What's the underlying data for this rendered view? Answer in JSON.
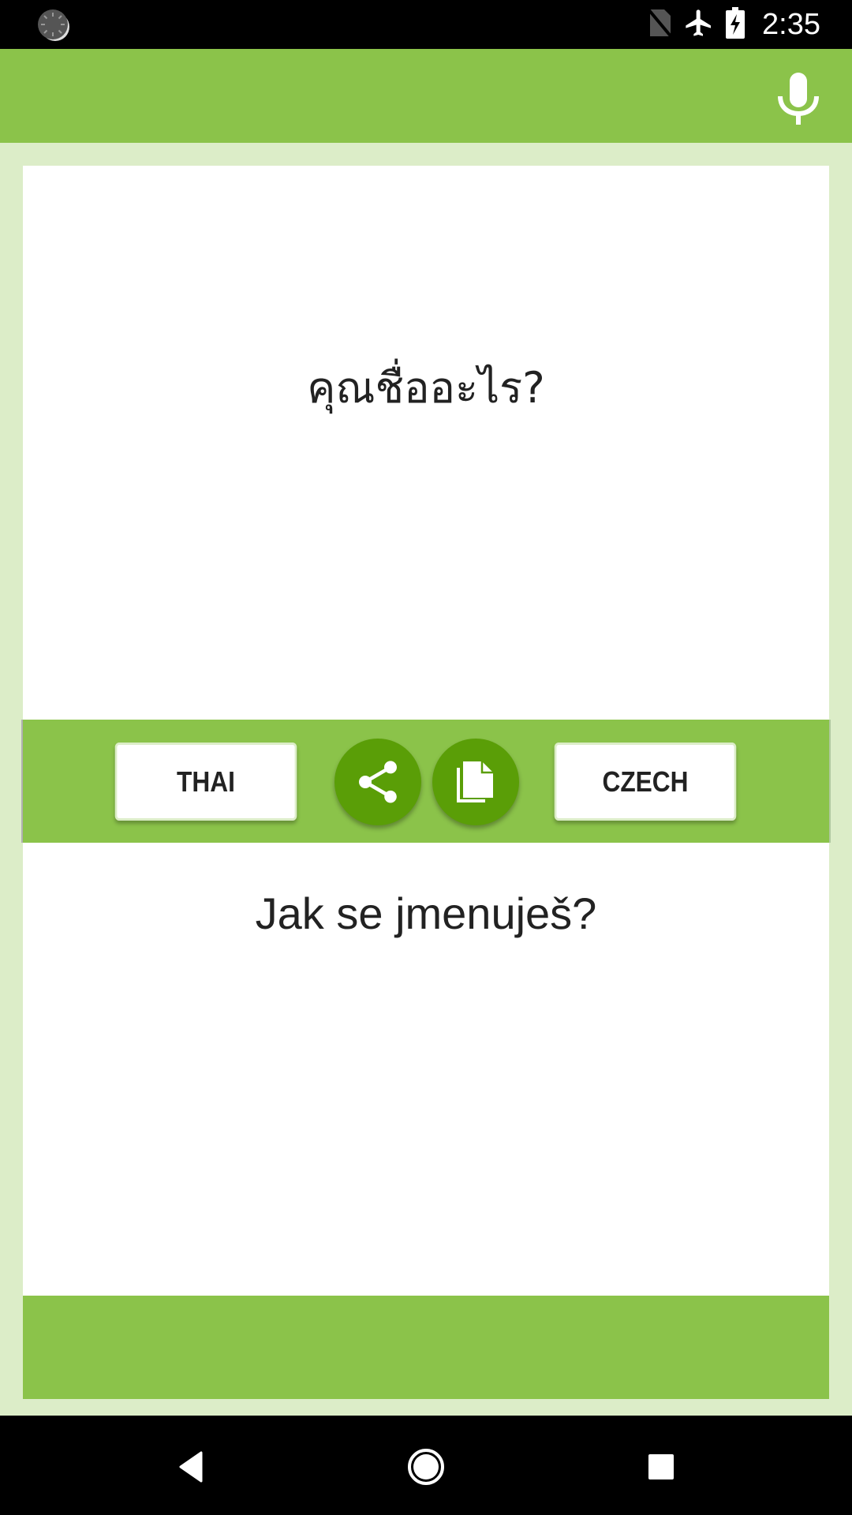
{
  "status_bar": {
    "time": "2:35",
    "icons": [
      "sync-icon",
      "no-sim-icon",
      "airplane-mode-icon",
      "battery-charging-icon"
    ]
  },
  "header": {
    "mic_icon": "microphone-icon"
  },
  "source_panel": {
    "language": "Thai",
    "text": "คุณชื่ออะไร?"
  },
  "toolbar": {
    "source_language_label": "THAI",
    "target_language_label": "CZECH",
    "share_icon": "share-icon",
    "copy_icon": "copy-icon"
  },
  "target_panel": {
    "language": "Czech",
    "text": "Jak se jmenuješ?"
  },
  "nav_bar": {
    "buttons": [
      "back",
      "home",
      "recents"
    ]
  },
  "colors": {
    "primary": "#8bc34a",
    "primary_dark": "#5a9e07",
    "background": "#dcedc8",
    "panel": "#ffffff",
    "text": "#222222"
  }
}
